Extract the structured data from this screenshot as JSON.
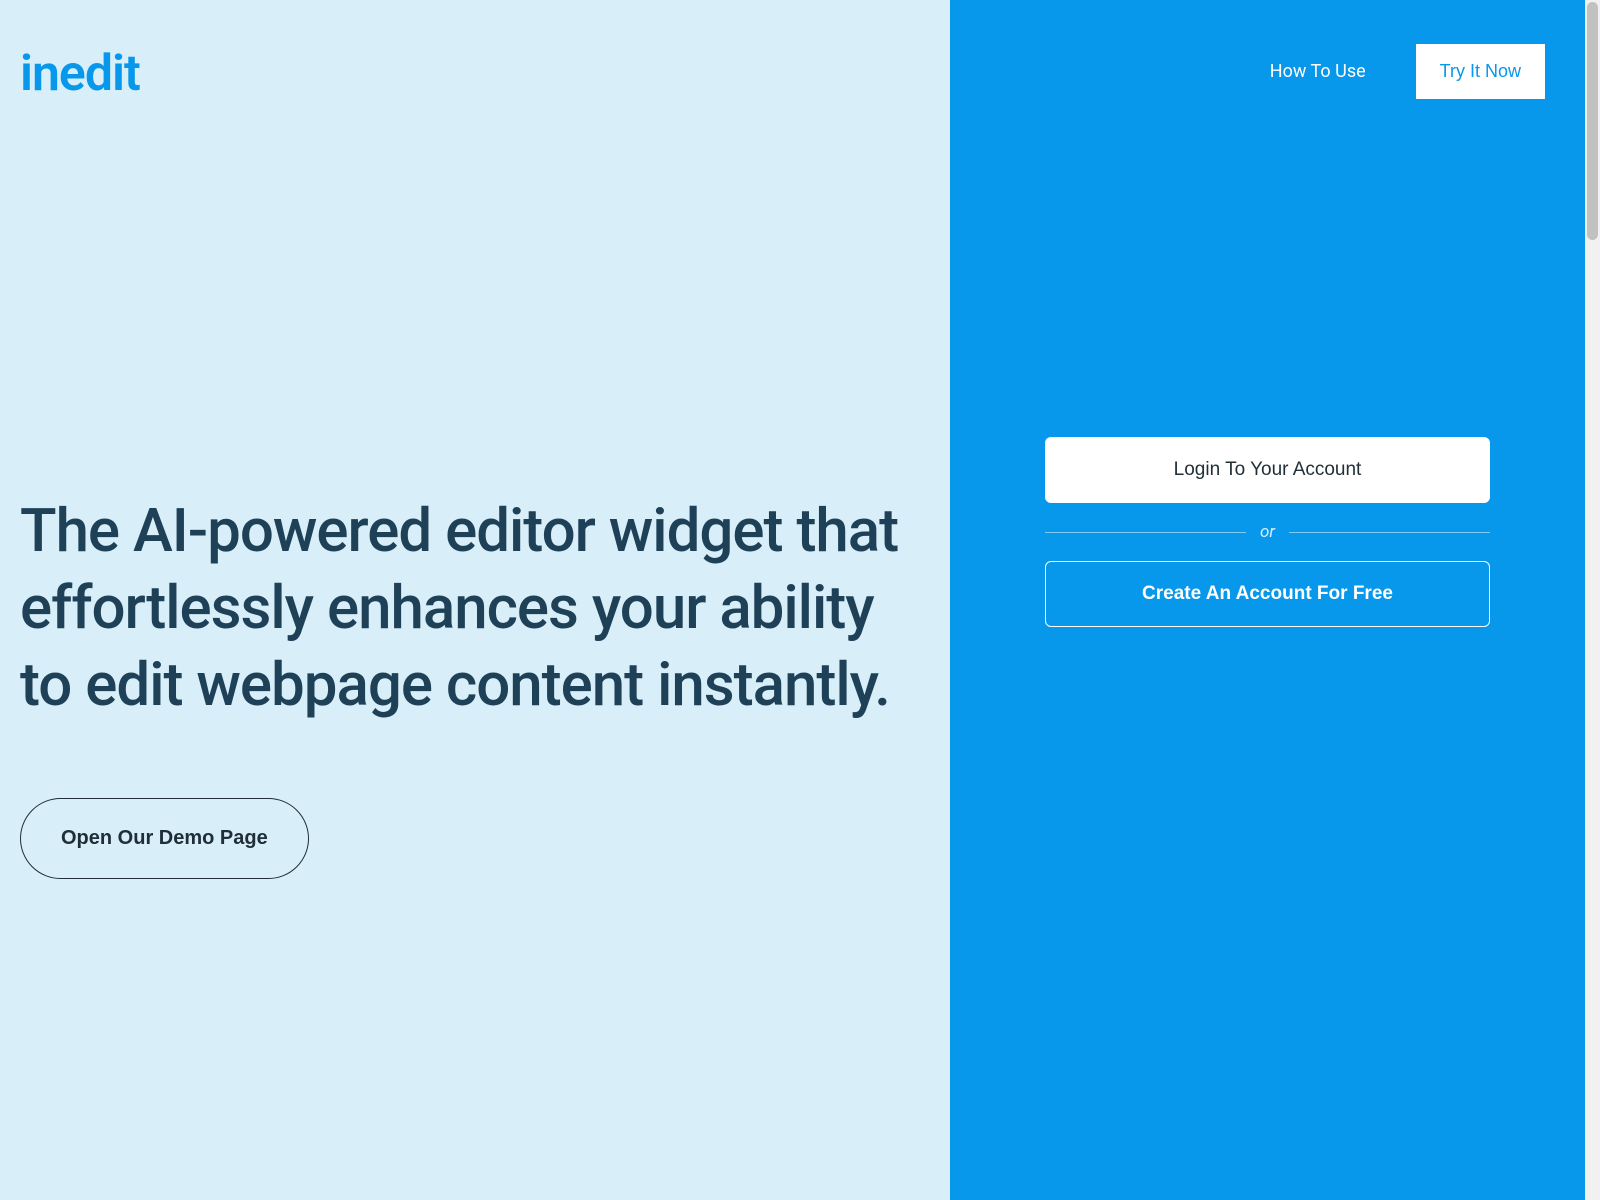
{
  "brand": {
    "logo_text": "inedit"
  },
  "hero": {
    "headline": "The AI-powered editor widget that effortlessly enhances your ability to edit webpage content instantly.",
    "demo_button_label": "Open Our Demo Page"
  },
  "nav": {
    "how_to_use_label": "How To Use",
    "try_now_label": "Try It Now"
  },
  "auth": {
    "login_label": "Login To Your Account",
    "or_label": "or",
    "signup_label": "Create An Account For Free"
  },
  "colors": {
    "left_bg": "#d8eef9",
    "right_bg": "#0797eb",
    "headline_text": "#1f4158",
    "logo_text": "#0797eb"
  }
}
